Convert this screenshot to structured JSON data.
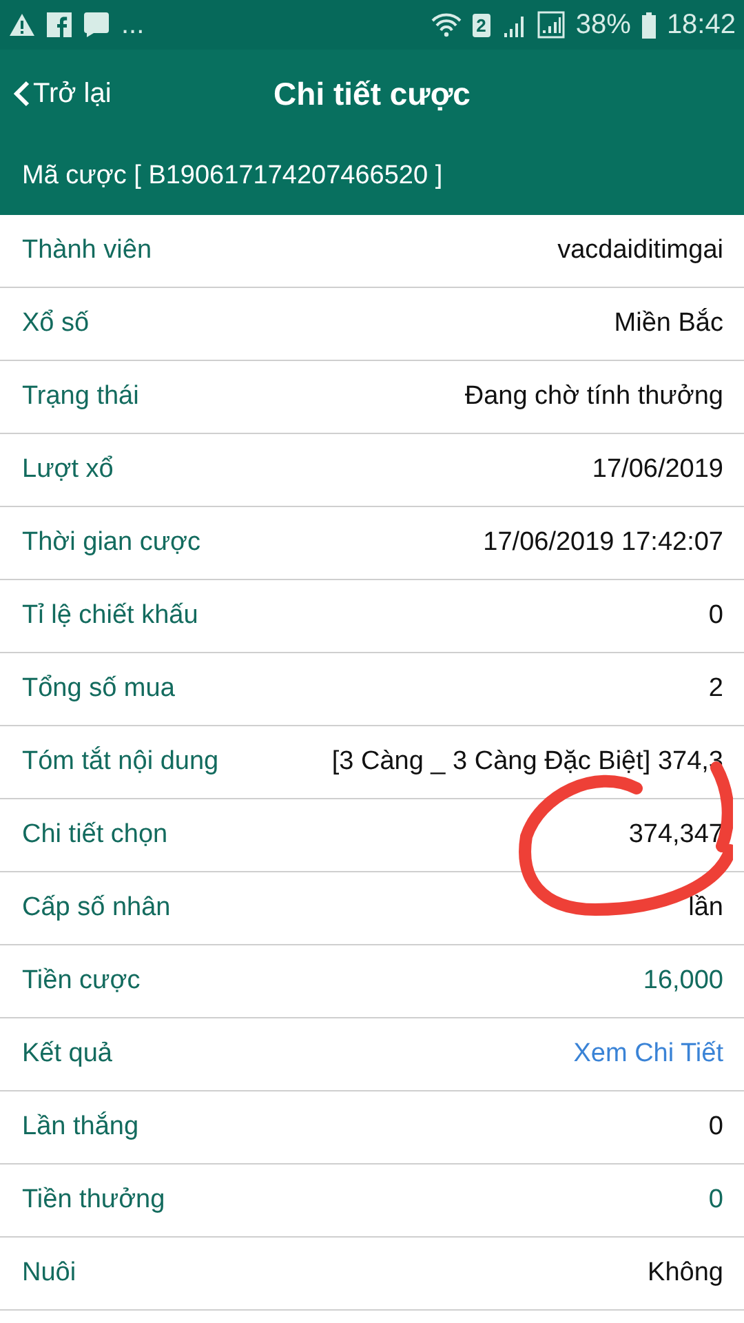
{
  "status_bar": {
    "more": "...",
    "sim": "2",
    "battery": "38%",
    "time": "18:42"
  },
  "header": {
    "back": "Trở lại",
    "title": "Chi tiết cược"
  },
  "bet_code": "Mã cược [ B190617174207466520 ]",
  "rows": [
    {
      "label": "Thành viên",
      "value": "vacdaiditimgai",
      "kind": "plain"
    },
    {
      "label": "Xổ số",
      "value": "Miền Bắc",
      "kind": "plain"
    },
    {
      "label": "Trạng thái",
      "value": "Đang chờ tính thưởng",
      "kind": "plain"
    },
    {
      "label": "Lượt xổ",
      "value": "17/06/2019",
      "kind": "plain"
    },
    {
      "label": "Thời gian cược",
      "value": "17/06/2019 17:42:07",
      "kind": "plain"
    },
    {
      "label": "Tỉ lệ chiết khấu",
      "value": "0",
      "kind": "plain"
    },
    {
      "label": "Tổng số mua",
      "value": "2",
      "kind": "plain"
    },
    {
      "label": "Tóm tắt nội dung",
      "value": "[3 Càng _ 3 Càng Đặc Biệt] 374,3",
      "kind": "plain"
    },
    {
      "label": "Chi tiết chọn",
      "value": "374,347",
      "kind": "plain"
    },
    {
      "label": "Cấp số nhân",
      "value": "lần",
      "kind": "plain"
    },
    {
      "label": "Tiền cược",
      "value": "16,000",
      "kind": "money"
    },
    {
      "label": "Kết quả",
      "value": "Xem Chi Tiết",
      "kind": "link"
    },
    {
      "label": "Lần thắng",
      "value": "0",
      "kind": "plain"
    },
    {
      "label": "Tiền thưởng",
      "value": "0",
      "kind": "money"
    },
    {
      "label": "Nuôi",
      "value": "Không",
      "kind": "plain"
    }
  ]
}
